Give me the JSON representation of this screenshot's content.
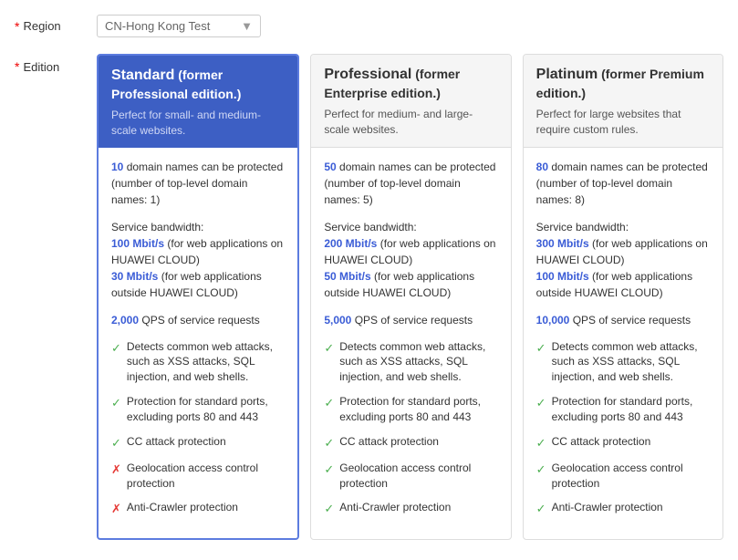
{
  "region": {
    "label": "Region",
    "value": "CN-Hong Kong Test",
    "placeholder": "CN-Hong Kong Test"
  },
  "edition": {
    "label": "Edition"
  },
  "cards": [
    {
      "id": "standard",
      "selected": true,
      "name": "Standard",
      "former": "(former Professional edition.)",
      "subtitle": "Perfect for small- and medium-scale websites.",
      "domains_highlight": "10",
      "domains_text": " domain names can be protected (number of top-level domain names: 1)",
      "bandwidth_label": "Service bandwidth:",
      "bandwidth_lines": [
        {
          "highlight": "100 Mbit/s",
          "text": " (for web applications on HUAWEI CLOUD)"
        },
        {
          "highlight": "30 Mbit/s",
          "text": " (for web applications outside HUAWEI CLOUD)"
        }
      ],
      "qps_highlight": "2,000",
      "qps_text": " QPS of service requests",
      "checks": [
        {
          "ok": true,
          "text": "Detects common web attacks, such as XSS attacks, SQL injection, and web shells."
        },
        {
          "ok": true,
          "text": "Protection for standard ports, excluding ports 80 and 443"
        },
        {
          "ok": true,
          "text": "CC attack protection"
        },
        {
          "ok": false,
          "text": "Geolocation access control protection"
        },
        {
          "ok": false,
          "text": "Anti-Crawler protection"
        }
      ]
    },
    {
      "id": "professional",
      "selected": false,
      "name": "Professional",
      "former": "(former Enterprise edition.)",
      "subtitle": "Perfect for medium- and large-scale websites.",
      "domains_highlight": "50",
      "domains_text": " domain names can be protected (number of top-level domain names: 5)",
      "bandwidth_label": "Service bandwidth:",
      "bandwidth_lines": [
        {
          "highlight": "200 Mbit/s",
          "text": " (for web applications on HUAWEI CLOUD)"
        },
        {
          "highlight": "50 Mbit/s",
          "text": " (for web applications outside HUAWEI CLOUD)"
        }
      ],
      "qps_highlight": "5,000",
      "qps_text": " QPS of service requests",
      "checks": [
        {
          "ok": true,
          "text": "Detects common web attacks, such as XSS attacks, SQL injection, and web shells."
        },
        {
          "ok": true,
          "text": "Protection for standard ports, excluding ports 80 and 443"
        },
        {
          "ok": true,
          "text": "CC attack protection"
        },
        {
          "ok": true,
          "text": "Geolocation access control protection"
        },
        {
          "ok": true,
          "text": "Anti-Crawler protection"
        }
      ]
    },
    {
      "id": "platinum",
      "selected": false,
      "name": "Platinum",
      "former": "(former Premium edition.)",
      "subtitle": "Perfect for large websites that require custom rules.",
      "domains_highlight": "80",
      "domains_text": " domain names can be protected (number of top-level domain names: 8)",
      "bandwidth_label": "Service bandwidth:",
      "bandwidth_lines": [
        {
          "highlight": "300 Mbit/s",
          "text": " (for web applications on HUAWEI CLOUD)"
        },
        {
          "highlight": "100 Mbit/s",
          "text": " (for web applications outside HUAWEI CLOUD)"
        }
      ],
      "qps_highlight": "10,000",
      "qps_text": " QPS of service requests",
      "checks": [
        {
          "ok": true,
          "text": "Detects common web attacks, such as XSS attacks, SQL injection, and web shells."
        },
        {
          "ok": true,
          "text": "Protection for standard ports, excluding ports 80 and 443"
        },
        {
          "ok": true,
          "text": "CC attack protection"
        },
        {
          "ok": true,
          "text": "Geolocation access control protection"
        },
        {
          "ok": true,
          "text": "Anti-Crawler protection"
        }
      ]
    }
  ]
}
